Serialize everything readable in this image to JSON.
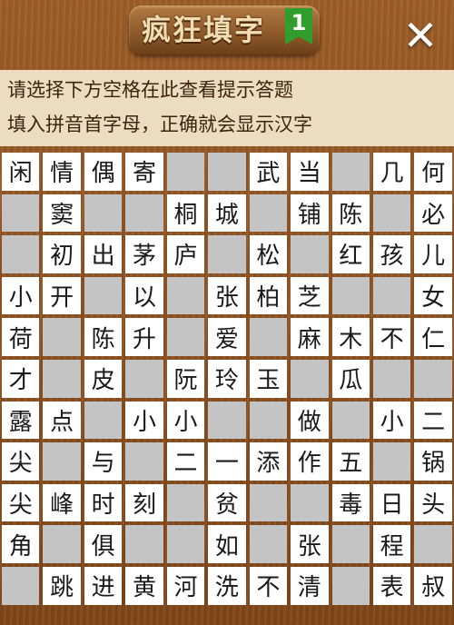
{
  "header": {
    "title": "疯狂填字",
    "level": "1",
    "close_label": "✕"
  },
  "hint": {
    "line1": "请选择下方空格在此查看提示答题",
    "line2": "填入拼音首字母，正确就会显示汉字"
  },
  "grid": {
    "rows": [
      [
        "闲",
        "情",
        "偶",
        "寄",
        "",
        "",
        "武",
        "当",
        "",
        "几",
        "何"
      ],
      [
        "",
        "窦",
        "",
        "",
        "桐",
        "城",
        "",
        "铺",
        "陈",
        "",
        "必"
      ],
      [
        "",
        "初",
        "出",
        "茅",
        "庐",
        "",
        "松",
        "",
        "红",
        "孩",
        "儿"
      ],
      [
        "小",
        "开",
        "",
        "以",
        "",
        "张",
        "柏",
        "芝",
        "",
        "",
        "女"
      ],
      [
        "荷",
        "",
        "陈",
        "升",
        "",
        "爱",
        "",
        "麻",
        "木",
        "不",
        "仁"
      ],
      [
        "才",
        "",
        "皮",
        "",
        "阮",
        "玲",
        "玉",
        "",
        "瓜",
        "",
        ""
      ],
      [
        "露",
        "点",
        "",
        "小",
        "小",
        "",
        "",
        "做",
        "",
        "小",
        "二"
      ],
      [
        "尖",
        "",
        "与",
        "",
        "二",
        "一",
        "添",
        "作",
        "五",
        "",
        "锅"
      ],
      [
        "尖",
        "峰",
        "时",
        "刻",
        "",
        "贫",
        "",
        "",
        "毒",
        "日",
        "头"
      ],
      [
        "角",
        "",
        "俱",
        "",
        "",
        "如",
        "",
        "张",
        "",
        "程",
        ""
      ],
      [
        "",
        "跳",
        "进",
        "黄",
        "河",
        "洗",
        "不",
        "清",
        "",
        "表",
        "叔"
      ]
    ]
  }
}
